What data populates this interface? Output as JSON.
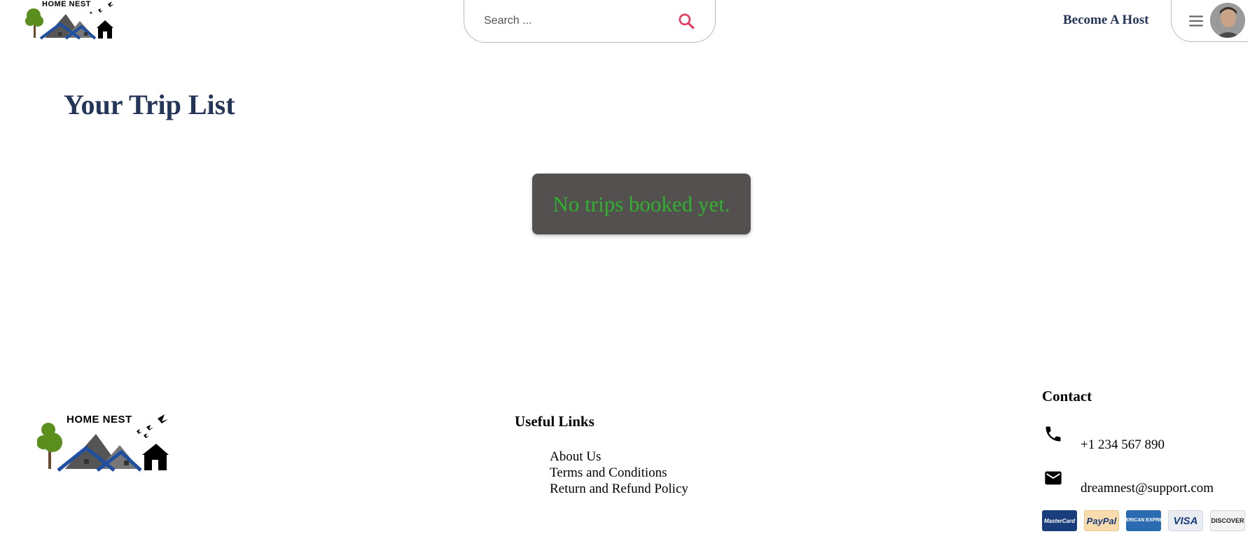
{
  "header": {
    "logo_text": "HOME NEST",
    "search": {
      "placeholder": "Search ...",
      "value": "",
      "icon": "search-icon"
    },
    "become_host_label": "Become A Host",
    "menu_icon": "hamburger-menu-icon",
    "avatar": "user-avatar"
  },
  "main": {
    "title": "Your Trip List",
    "empty_message": "No trips booked yet."
  },
  "footer": {
    "logo_text": "HOME NEST",
    "useful_links": {
      "heading": "Useful Links",
      "items": [
        {
          "label": "About Us"
        },
        {
          "label": "Terms and Conditions"
        },
        {
          "label": "Return and Refund Policy"
        }
      ]
    },
    "contact": {
      "heading": "Contact",
      "phone": "+1 234 567 890",
      "email": "dreamnest@support.com",
      "phone_icon": "phone-icon",
      "email_icon": "mail-icon"
    },
    "payments": [
      {
        "name": "mastercard",
        "label": "MasterCard"
      },
      {
        "name": "paypal",
        "label": "PayPal"
      },
      {
        "name": "amex",
        "label": "AMERICAN EXPRESS"
      },
      {
        "name": "visa",
        "label": "VISA"
      },
      {
        "name": "discover",
        "label": "DISCOVER"
      }
    ]
  },
  "colors": {
    "brand_navy": "#24355a",
    "search_accent": "#e8365d",
    "empty_box_bg": "#545050",
    "empty_text_green": "#2db32d",
    "logo_green": "#5a8f1e",
    "logo_blue": "#1f4fa0",
    "logo_gray": "#555555"
  }
}
